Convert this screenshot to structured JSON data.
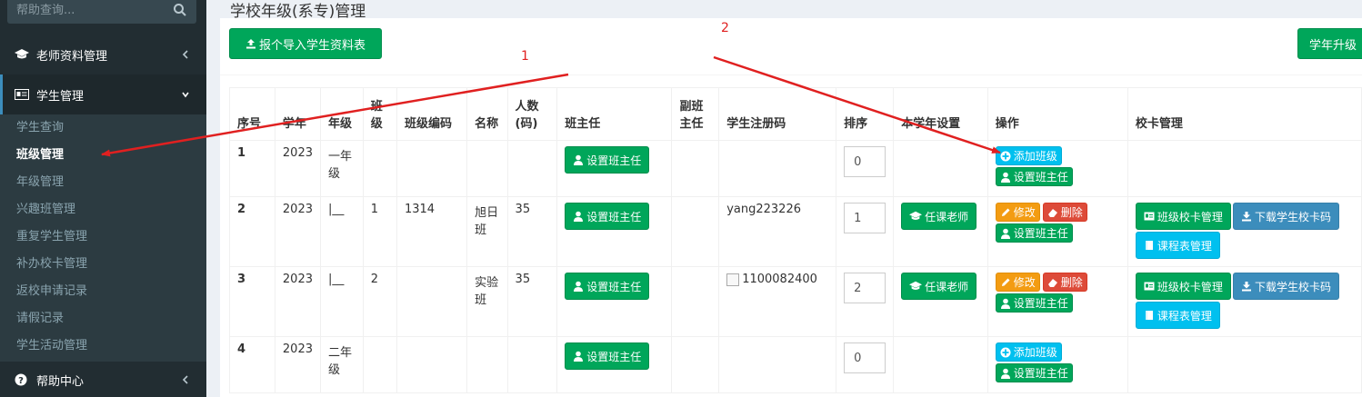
{
  "sidebar": {
    "search_placeholder": "帮助查询...",
    "menu": [
      {
        "label": "老师资料管理"
      },
      {
        "label": "学生管理"
      },
      {
        "label": "帮助中心"
      }
    ],
    "submenu": [
      {
        "label": "学生查询"
      },
      {
        "label": "班级管理"
      },
      {
        "label": "年级管理"
      },
      {
        "label": "兴趣班管理"
      },
      {
        "label": "重复学生管理"
      },
      {
        "label": "补办校卡管理"
      },
      {
        "label": "返校申请记录"
      },
      {
        "label": "请假记录"
      },
      {
        "label": "学生活动管理"
      }
    ]
  },
  "page": {
    "title": "学校年级(系专)管理",
    "import_label": "报个导入学生资料表",
    "upgrade_label": "学年升级"
  },
  "table": {
    "headers": [
      "序号",
      "学年",
      "年级",
      "班级",
      "班级编码",
      "名称",
      "人数(码)",
      "班主任",
      "副班主任",
      "学生注册码",
      "排序",
      "本学年设置",
      "操作",
      "校卡管理"
    ],
    "rows": [
      {
        "no": "1",
        "year": "2023",
        "grade": "一年级",
        "class": "",
        "code": "",
        "name": "",
        "count": "",
        "reg": "",
        "order": "0",
        "type": "grade"
      },
      {
        "no": "2",
        "year": "2023",
        "grade": "|__",
        "class": "1",
        "code": "1314",
        "name": "旭日班",
        "count": "35",
        "reg": "yang223226",
        "order": "1",
        "type": "class"
      },
      {
        "no": "3",
        "year": "2023",
        "grade": "|__",
        "class": "2",
        "code": "",
        "name": "实验班",
        "count": "35",
        "reg": "1100082400",
        "order": "2",
        "type": "class"
      },
      {
        "no": "4",
        "year": "2023",
        "grade": "二年级",
        "class": "",
        "code": "",
        "name": "",
        "count": "",
        "reg": "",
        "order": "0",
        "type": "grade"
      }
    ]
  },
  "buttons": {
    "set_head_teacher": "设置班主任",
    "add_class": "添加班级",
    "course_teacher": "任课老师",
    "edit": "修改",
    "delete": "删除",
    "class_card_mgmt": "班级校卡管理",
    "download_card": "下载学生校卡码",
    "timetable_mgmt": "课程表管理"
  },
  "annotations": {
    "label_1": "1",
    "label_2": "2",
    "color": "#e02020"
  }
}
